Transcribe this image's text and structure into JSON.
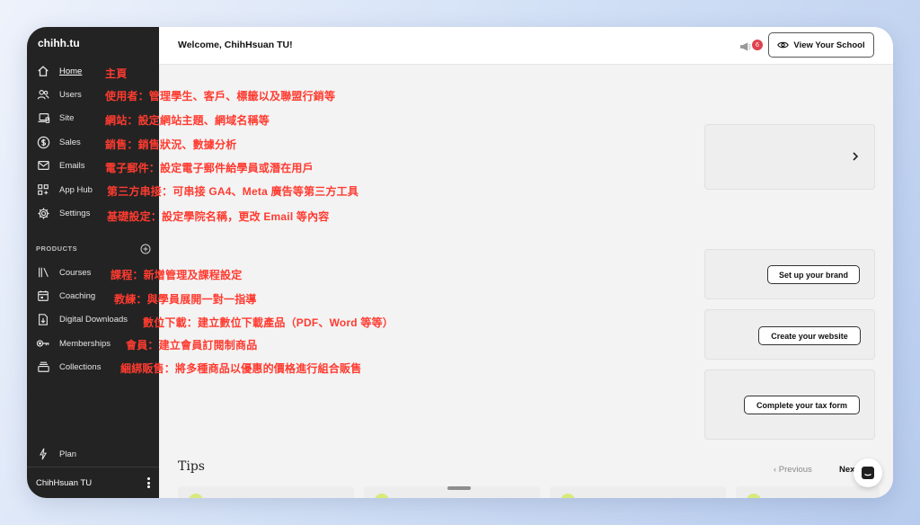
{
  "sidebar": {
    "brand": "chihh.tu",
    "items": [
      {
        "label": "Home",
        "icon": "home-icon",
        "annotation": "主頁"
      },
      {
        "label": "Users",
        "icon": "users-icon",
        "annotation": "使用者：管理學生、客戶、標籤以及聯盟行銷等"
      },
      {
        "label": "Site",
        "icon": "site-icon",
        "annotation": "網站：設定網站主題、網域名稱等"
      },
      {
        "label": "Sales",
        "icon": "dollar-icon",
        "annotation": "銷售：銷售狀況、數據分析"
      },
      {
        "label": "Emails",
        "icon": "mail-icon",
        "annotation": "電子郵件：設定電子郵件給學員或潛在用戶"
      },
      {
        "label": "App Hub",
        "icon": "apps-icon",
        "annotation": "第三方串接：可串接 GA4、Meta 廣告等第三方工具"
      },
      {
        "label": "Settings",
        "icon": "gear-icon",
        "annotation": "基礎設定：設定學院名稱，更改 Email 等內容"
      }
    ],
    "products_label": "PRODUCTS",
    "products": [
      {
        "label": "Courses",
        "icon": "library-icon",
        "annotation": "課程：新增管理及課程設定"
      },
      {
        "label": "Coaching",
        "icon": "calendar-icon",
        "annotation": "教練：與學員展開一對一指導"
      },
      {
        "label": "Digital Downloads",
        "icon": "download-icon",
        "annotation": "數位下載：建立數位下載產品（PDF、Word 等等）"
      },
      {
        "label": "Memberships",
        "icon": "key-icon",
        "annotation": "會員：建立會員訂閱制商品"
      },
      {
        "label": "Collections",
        "icon": "stack-icon",
        "annotation": "綑綁販售：將多種商品以優惠的價格進行組合販售"
      }
    ],
    "plan_label": "Plan",
    "user_name": "ChihHsuan TU"
  },
  "header": {
    "welcome": "Welcome, ChihHsuan TU!",
    "notification_count": "6",
    "view_school_label": "View Your School"
  },
  "main": {
    "card_buttons": [
      "Set up your brand",
      "Create your website",
      "Complete your tax form"
    ],
    "tips_title": "Tips",
    "previous_label": "‹ Previous",
    "next_label": "Nex"
  },
  "colors": {
    "sidebar_bg": "#232323",
    "annotation": "#ff3b30",
    "badge": "#e0424f"
  }
}
